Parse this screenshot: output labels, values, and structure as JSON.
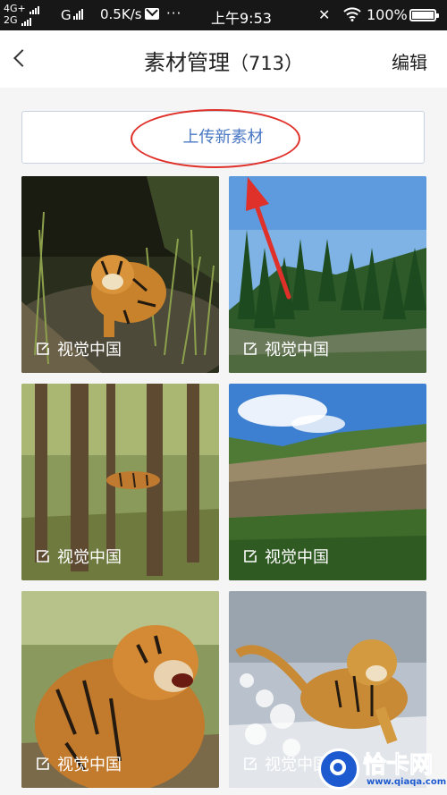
{
  "status_bar": {
    "net_top": "4G+",
    "net_bottom": "2G",
    "g_label": "G",
    "speed": "0.5K/s",
    "dots": "···",
    "time": "上午9:53",
    "battery": "100%"
  },
  "header": {
    "title": "素材管理",
    "count": "（713）",
    "edit": "编辑"
  },
  "upload": {
    "label": "上传新素材"
  },
  "tiles": [
    {
      "label": "视觉中国",
      "scene": "tiger-in-grass"
    },
    {
      "label": "视觉中国",
      "scene": "pine-forest-hill"
    },
    {
      "label": "视觉中国",
      "scene": "tiger-in-woods"
    },
    {
      "label": "视觉中国",
      "scene": "rocky-cliff"
    },
    {
      "label": "视觉中国",
      "scene": "tiger-roaring"
    },
    {
      "label": "视觉中国",
      "scene": "tiger-running-snow"
    }
  ],
  "watermark": {
    "brand": "恰卡网",
    "url": "www.qiaqa.com"
  },
  "colors": {
    "accent": "#4a78c4",
    "annotation_red": "#e0302a",
    "status_bar": "#171717",
    "background": "#f5f5f5"
  }
}
